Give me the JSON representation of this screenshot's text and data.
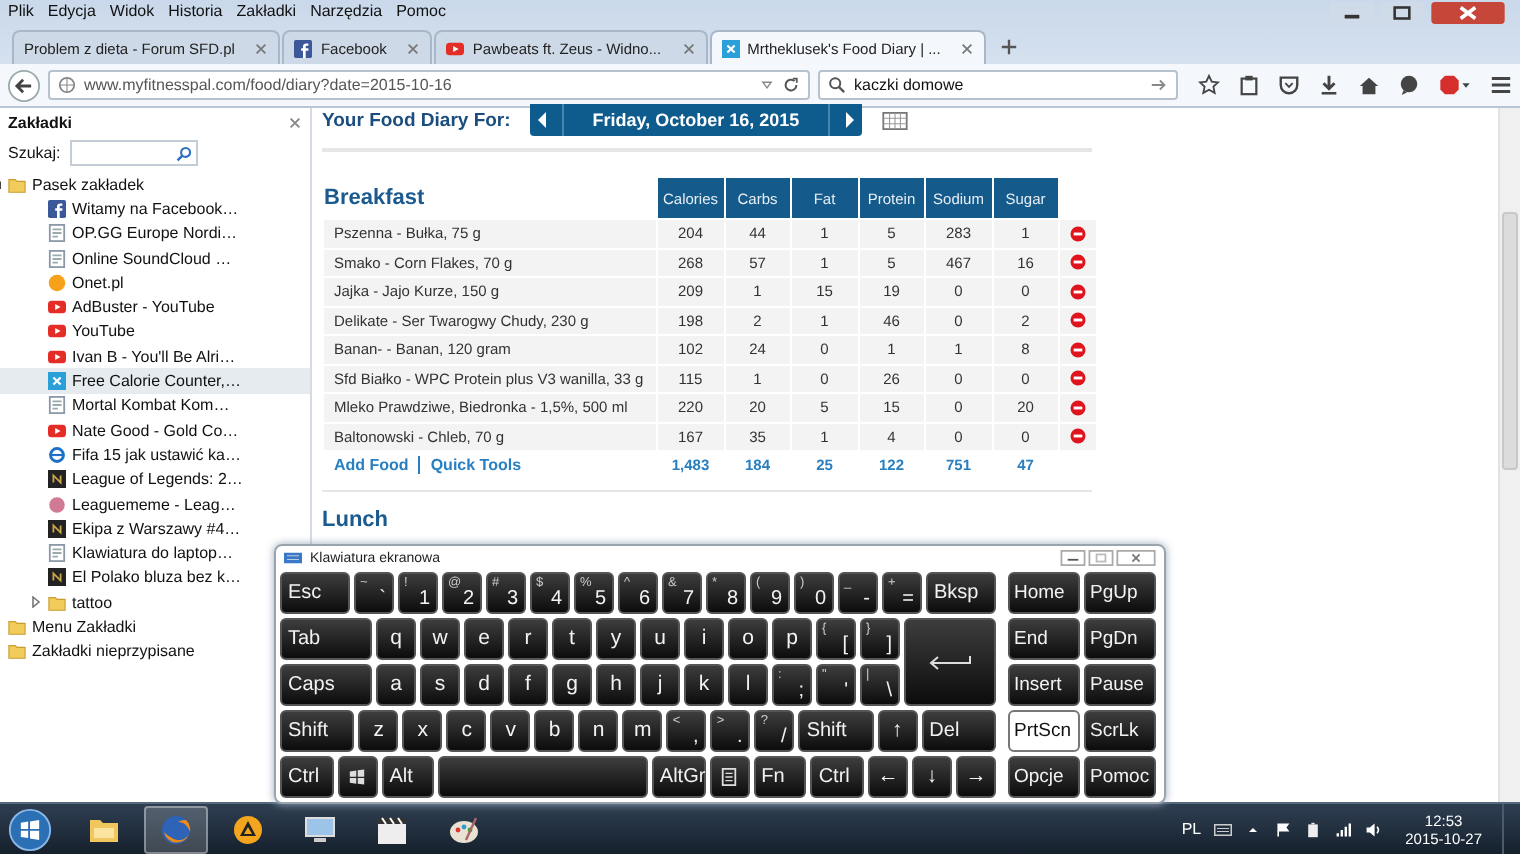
{
  "menu_bar": [
    "Plik",
    "Edycja",
    "Widok",
    "Historia",
    "Zakładki",
    "Narzędzia",
    "Pomoc"
  ],
  "tabs": [
    {
      "title": "Problem z dieta - Forum SFD.pl",
      "kind": "plain",
      "selected": false
    },
    {
      "title": "Facebook",
      "kind": "facebook",
      "selected": false
    },
    {
      "title": "Pawbeats ft. Zeus - Widno...",
      "kind": "youtube",
      "selected": false
    },
    {
      "title": "Mrtheklusek's Food Diary | ...",
      "kind": "mfp",
      "selected": true
    }
  ],
  "address_bar": {
    "url": "www.myfitnesspal.com/food/diary?date=2015-10-16",
    "search": "kaczki domowe"
  },
  "sidebar": {
    "title": "Zakładki",
    "search_label": "Szukaj:",
    "items": [
      {
        "label": "Pasek zakładek",
        "kind": "folder",
        "expanded": true,
        "selected": false,
        "children": [
          {
            "label": "Witamy na Facebook…",
            "kind": "facebook",
            "selected": false
          },
          {
            "label": "OP.GG Europe Nordi…",
            "kind": "page",
            "selected": false
          },
          {
            "label": "Online SoundCloud …",
            "kind": "page",
            "selected": false
          },
          {
            "label": "Onet.pl",
            "kind": "orange",
            "selected": false
          },
          {
            "label": "AdBuster - YouTube",
            "kind": "youtube",
            "selected": false
          },
          {
            "label": "YouTube",
            "kind": "youtube",
            "selected": false
          },
          {
            "label": "Ivan B - You'll Be Alri…",
            "kind": "youtube",
            "selected": false
          },
          {
            "label": "Free Calorie Counter,…",
            "kind": "mfp",
            "selected": true
          },
          {
            "label": "Mortal Kombat Kom…",
            "kind": "page",
            "selected": false
          },
          {
            "label": "Nate Good - Gold Co…",
            "kind": "youtube",
            "selected": false
          },
          {
            "label": "Fifa 15 jak ustawić ka…",
            "kind": "globe",
            "selected": false
          },
          {
            "label": "League of Legends: 2…",
            "kind": "dark",
            "selected": false
          },
          {
            "label": "Leaguememe - Leag…",
            "kind": "pink",
            "selected": false
          },
          {
            "label": "Ekipa z Warszawy #4…",
            "kind": "dark",
            "selected": false
          },
          {
            "label": "Klawiatura do laptop…",
            "kind": "page",
            "selected": false
          },
          {
            "label": "El Polako bluza bez k…",
            "kind": "dark",
            "selected": false
          },
          {
            "label": "tattoo",
            "kind": "folder",
            "expanded": false,
            "selected": false
          }
        ]
      },
      {
        "label": "Menu Zakładki",
        "kind": "folder",
        "expanded": false,
        "selected": false
      },
      {
        "label": "Zakładki nieprzypisane",
        "kind": "folder",
        "expanded": false,
        "selected": false
      }
    ]
  },
  "diary": {
    "heading": "Your Food Diary For:",
    "date": "Friday, October 16, 2015"
  },
  "breakfast": {
    "title": "Breakfast",
    "columns": [
      "Calories",
      "Carbs",
      "Fat",
      "Protein",
      "Sodium",
      "Sugar"
    ],
    "rows": [
      {
        "food": "Pszenna - Bułka, 75 g",
        "values": [
          "204",
          "44",
          "1",
          "5",
          "283",
          "1"
        ]
      },
      {
        "food": "Smako - Corn Flakes, 70 g",
        "values": [
          "268",
          "57",
          "1",
          "5",
          "467",
          "16"
        ]
      },
      {
        "food": "Jajka - Jajo Kurze, 150 g",
        "values": [
          "209",
          "1",
          "15",
          "19",
          "0",
          "0"
        ]
      },
      {
        "food": "Delikate - Ser Twarogwy Chudy, 230 g",
        "values": [
          "198",
          "2",
          "1",
          "46",
          "0",
          "2"
        ]
      },
      {
        "food": "Banan- - Banan, 120 gram",
        "values": [
          "102",
          "24",
          "0",
          "1",
          "1",
          "8"
        ]
      },
      {
        "food": "Sfd Białko - WPC Protein plus V3 wanilla, 33 g",
        "values": [
          "115",
          "1",
          "0",
          "26",
          "0",
          "0"
        ]
      },
      {
        "food": "Mleko Prawdziwe, Biedronka - 1,5%, 500 ml",
        "values": [
          "220",
          "20",
          "5",
          "15",
          "0",
          "20"
        ]
      },
      {
        "food": "Baltonowski - Chleb, 70 g",
        "values": [
          "167",
          "35",
          "1",
          "4",
          "0",
          "0"
        ]
      }
    ],
    "links": [
      "Add Food",
      "Quick Tools"
    ],
    "totals": [
      "1,483",
      "184",
      "25",
      "122",
      "751",
      "47"
    ]
  },
  "lunch": {
    "title": "Lunch"
  },
  "keyboard": {
    "title": "Klawiatura ekranowa",
    "rows": [
      {
        "keys": [
          {
            "kind": "fn",
            "label": "Esc"
          },
          {
            "kind": "char",
            "shift": "~",
            "label": "`"
          },
          {
            "kind": "char",
            "shift": "!",
            "label": "1"
          },
          {
            "kind": "char",
            "shift": "@",
            "label": "2"
          },
          {
            "kind": "char",
            "shift": "#",
            "label": "3"
          },
          {
            "kind": "char",
            "shift": "$",
            "label": "4"
          },
          {
            "kind": "char",
            "shift": "%",
            "label": "5"
          },
          {
            "kind": "char",
            "shift": "^",
            "label": "6"
          },
          {
            "kind": "char",
            "shift": "&",
            "label": "7"
          },
          {
            "kind": "char",
            "shift": "*",
            "label": "8"
          },
          {
            "kind": "char",
            "shift": "(",
            "label": "9"
          },
          {
            "kind": "char",
            "shift": ")",
            "label": "0"
          },
          {
            "kind": "char",
            "shift": "_",
            "label": "-"
          },
          {
            "kind": "char",
            "shift": "+",
            "label": "="
          },
          {
            "kind": "fn",
            "label": "Bksp"
          }
        ]
      },
      {
        "keys": [
          {
            "kind": "fn",
            "label": "Tab"
          },
          {
            "kind": "letter",
            "label": "q"
          },
          {
            "kind": "letter",
            "label": "w"
          },
          {
            "kind": "letter",
            "label": "e"
          },
          {
            "kind": "letter",
            "label": "r"
          },
          {
            "kind": "letter",
            "label": "t"
          },
          {
            "kind": "letter",
            "label": "y"
          },
          {
            "kind": "letter",
            "label": "u"
          },
          {
            "kind": "letter",
            "label": "i"
          },
          {
            "kind": "letter",
            "label": "o"
          },
          {
            "kind": "letter",
            "label": "p"
          },
          {
            "kind": "char",
            "shift": "{",
            "label": "["
          },
          {
            "kind": "char",
            "shift": "}",
            "label": "]"
          },
          {
            "kind": "enter"
          }
        ]
      },
      {
        "keys": [
          {
            "kind": "fn",
            "label": "Caps"
          },
          {
            "kind": "letter",
            "label": "a"
          },
          {
            "kind": "letter",
            "label": "s"
          },
          {
            "kind": "letter",
            "label": "d"
          },
          {
            "kind": "letter",
            "label": "f"
          },
          {
            "kind": "letter",
            "label": "g"
          },
          {
            "kind": "letter",
            "label": "h"
          },
          {
            "kind": "letter",
            "label": "j"
          },
          {
            "kind": "letter",
            "label": "k"
          },
          {
            "kind": "letter",
            "label": "l"
          },
          {
            "kind": "char",
            "shift": ":",
            "label": ";"
          },
          {
            "kind": "char",
            "shift": "\"",
            "label": "'"
          },
          {
            "kind": "char",
            "shift": "|",
            "label": "\\"
          }
        ]
      },
      {
        "keys": [
          {
            "kind": "fn",
            "label": "Shift"
          },
          {
            "kind": "letter",
            "label": "z"
          },
          {
            "kind": "letter",
            "label": "x"
          },
          {
            "kind": "letter",
            "label": "c"
          },
          {
            "kind": "letter",
            "label": "v"
          },
          {
            "kind": "letter",
            "label": "b"
          },
          {
            "kind": "letter",
            "label": "n"
          },
          {
            "kind": "letter",
            "label": "m"
          },
          {
            "kind": "char",
            "shift": "<",
            "label": ","
          },
          {
            "kind": "char",
            "shift": ">",
            "label": "."
          },
          {
            "kind": "char",
            "shift": "?",
            "label": "/"
          },
          {
            "kind": "fn",
            "label": "Shift"
          },
          {
            "kind": "letter",
            "label": "↑"
          },
          {
            "kind": "fn",
            "label": "Del"
          }
        ]
      },
      {
        "keys": [
          {
            "kind": "fn",
            "label": "Ctrl"
          },
          {
            "kind": "win"
          },
          {
            "kind": "fn",
            "label": "Alt"
          },
          {
            "kind": "space"
          },
          {
            "kind": "fn",
            "label": "AltGr"
          },
          {
            "kind": "menu"
          },
          {
            "kind": "fn",
            "label": "Fn"
          },
          {
            "kind": "fn",
            "label": "Ctrl"
          },
          {
            "kind": "letter",
            "label": "←"
          },
          {
            "kind": "letter",
            "label": "↓"
          },
          {
            "kind": "letter",
            "label": "→"
          }
        ]
      }
    ],
    "nav_keys": [
      {
        "label": "Home",
        "pressed": false
      },
      {
        "label": "PgUp",
        "pressed": false
      },
      {
        "label": "End",
        "pressed": false
      },
      {
        "label": "PgDn",
        "pressed": false
      },
      {
        "label": "Insert",
        "pressed": false
      },
      {
        "label": "Pause",
        "pressed": false
      },
      {
        "label": "PrtScn",
        "pressed": true
      },
      {
        "label": "ScrLk",
        "pressed": false
      },
      {
        "label": "Opcje",
        "pressed": false
      },
      {
        "label": "Pomoc",
        "pressed": false
      }
    ]
  },
  "taskbar": {
    "apps": [
      {
        "kind": "folder",
        "selected": false
      },
      {
        "kind": "browser",
        "selected": true
      },
      {
        "kind": "cone",
        "selected": false
      },
      {
        "kind": "monitor",
        "selected": false
      },
      {
        "kind": "clapper",
        "selected": false
      },
      {
        "kind": "palette",
        "selected": false
      }
    ],
    "language": "PL",
    "time": "12:53",
    "date": "2015-10-27"
  }
}
